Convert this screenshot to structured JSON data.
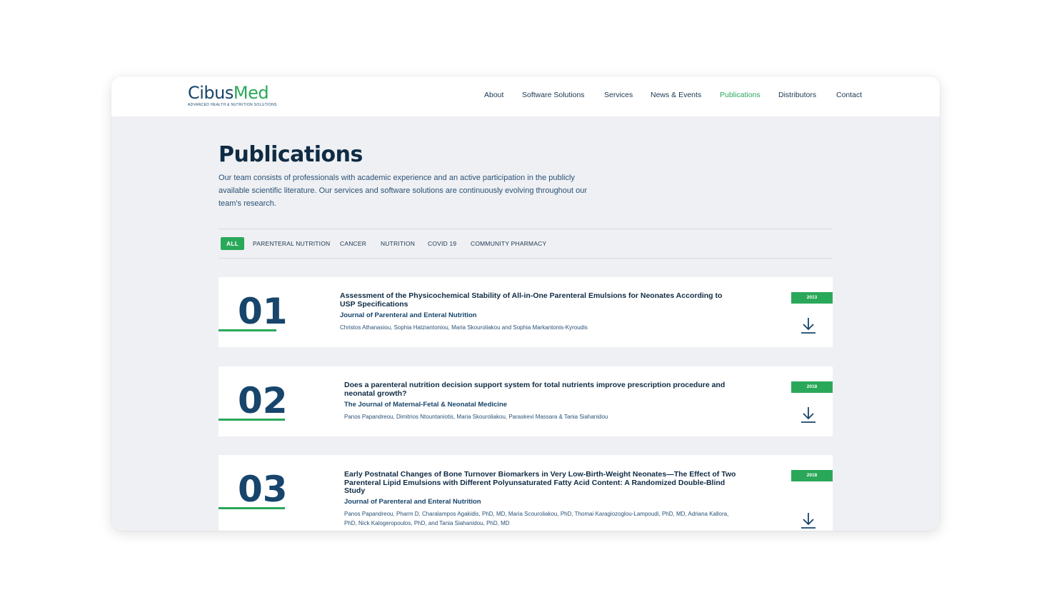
{
  "brand": {
    "name_part1": "Cibus",
    "name_part2": "Med",
    "tagline": "ADVANCED HEALTH & NUTRITION SOLUTIONS",
    "color_primary": "#17456b",
    "color_accent": "#2aa85a"
  },
  "nav": {
    "items": [
      {
        "label": "About",
        "active": false
      },
      {
        "label": "Software Solutions",
        "active": false
      },
      {
        "label": "Services",
        "active": false
      },
      {
        "label": "News & Events",
        "active": false
      },
      {
        "label": "Publications",
        "active": true
      },
      {
        "label": "Distributors",
        "active": false
      },
      {
        "label": "Contact",
        "active": false
      }
    ]
  },
  "page": {
    "title": "Publications",
    "intro": "Our team consists of professionals with academic experience and an active participation in the publicly available scientific literature. Our services and software solutions are continuously evolving throughout our team's research."
  },
  "filters": [
    {
      "label": "ALL",
      "active": true
    },
    {
      "label": "PARENTERAL NUTRITION",
      "active": false
    },
    {
      "label": "CANCER",
      "active": false
    },
    {
      "label": "NUTRITION",
      "active": false
    },
    {
      "label": "COVID 19",
      "active": false
    },
    {
      "label": "COMMUNITY PHARMACY",
      "active": false
    }
  ],
  "publications": [
    {
      "number": "01",
      "title": "Assessment of the Physicochemical Stability of All-in-One Parenteral Emulsions for Neonates According to USP Specifications",
      "journal": "Journal of Parenteral and Enteral Nutrition",
      "authors": "Christos Athanasiou, Sophia Hatziantoniou, Maria Skouroliakou and Sophia Markantonis-Kyroudis",
      "year": "2013",
      "download_icon": "download-icon"
    },
    {
      "number": "02",
      "title": "Does a parenteral nutrition decision support system for total nutrients improve prescription procedure and neonatal growth?",
      "journal": "The Journal of Maternal-Fetal & Neonatal Medicine",
      "authors": "Panos Papandreou, Dimitrios Ntountaniotis, Maria Skouroliakou, Paraskevi Massara & Tania Siahanidou",
      "year": "2018",
      "download_icon": "download-icon"
    },
    {
      "number": "03",
      "title": "Early Postnatal Changes of Bone Turnover Biomarkers in Very Low-Birth-Weight Neonates—The Effect of Two Parenteral Lipid Emulsions with Different Polyunsaturated Fatty Acid Content: A Randomized Double-Blind Study",
      "journal": "Journal of Parenteral and Enteral Nutrition",
      "authors": "Panos Papandreou, Pharm D, Charalampos Agakidis, PhD, MD, Maria Scouroliakou, PhD, Thomai Karagiozoglou-Lampoudi, PhD, MD, Adriana Kallora, PhD, Nick Kalogeropoulos, PhD, and Tania Siahanidou, PhD, MD",
      "year": "2018",
      "download_icon": "download-icon"
    }
  ]
}
